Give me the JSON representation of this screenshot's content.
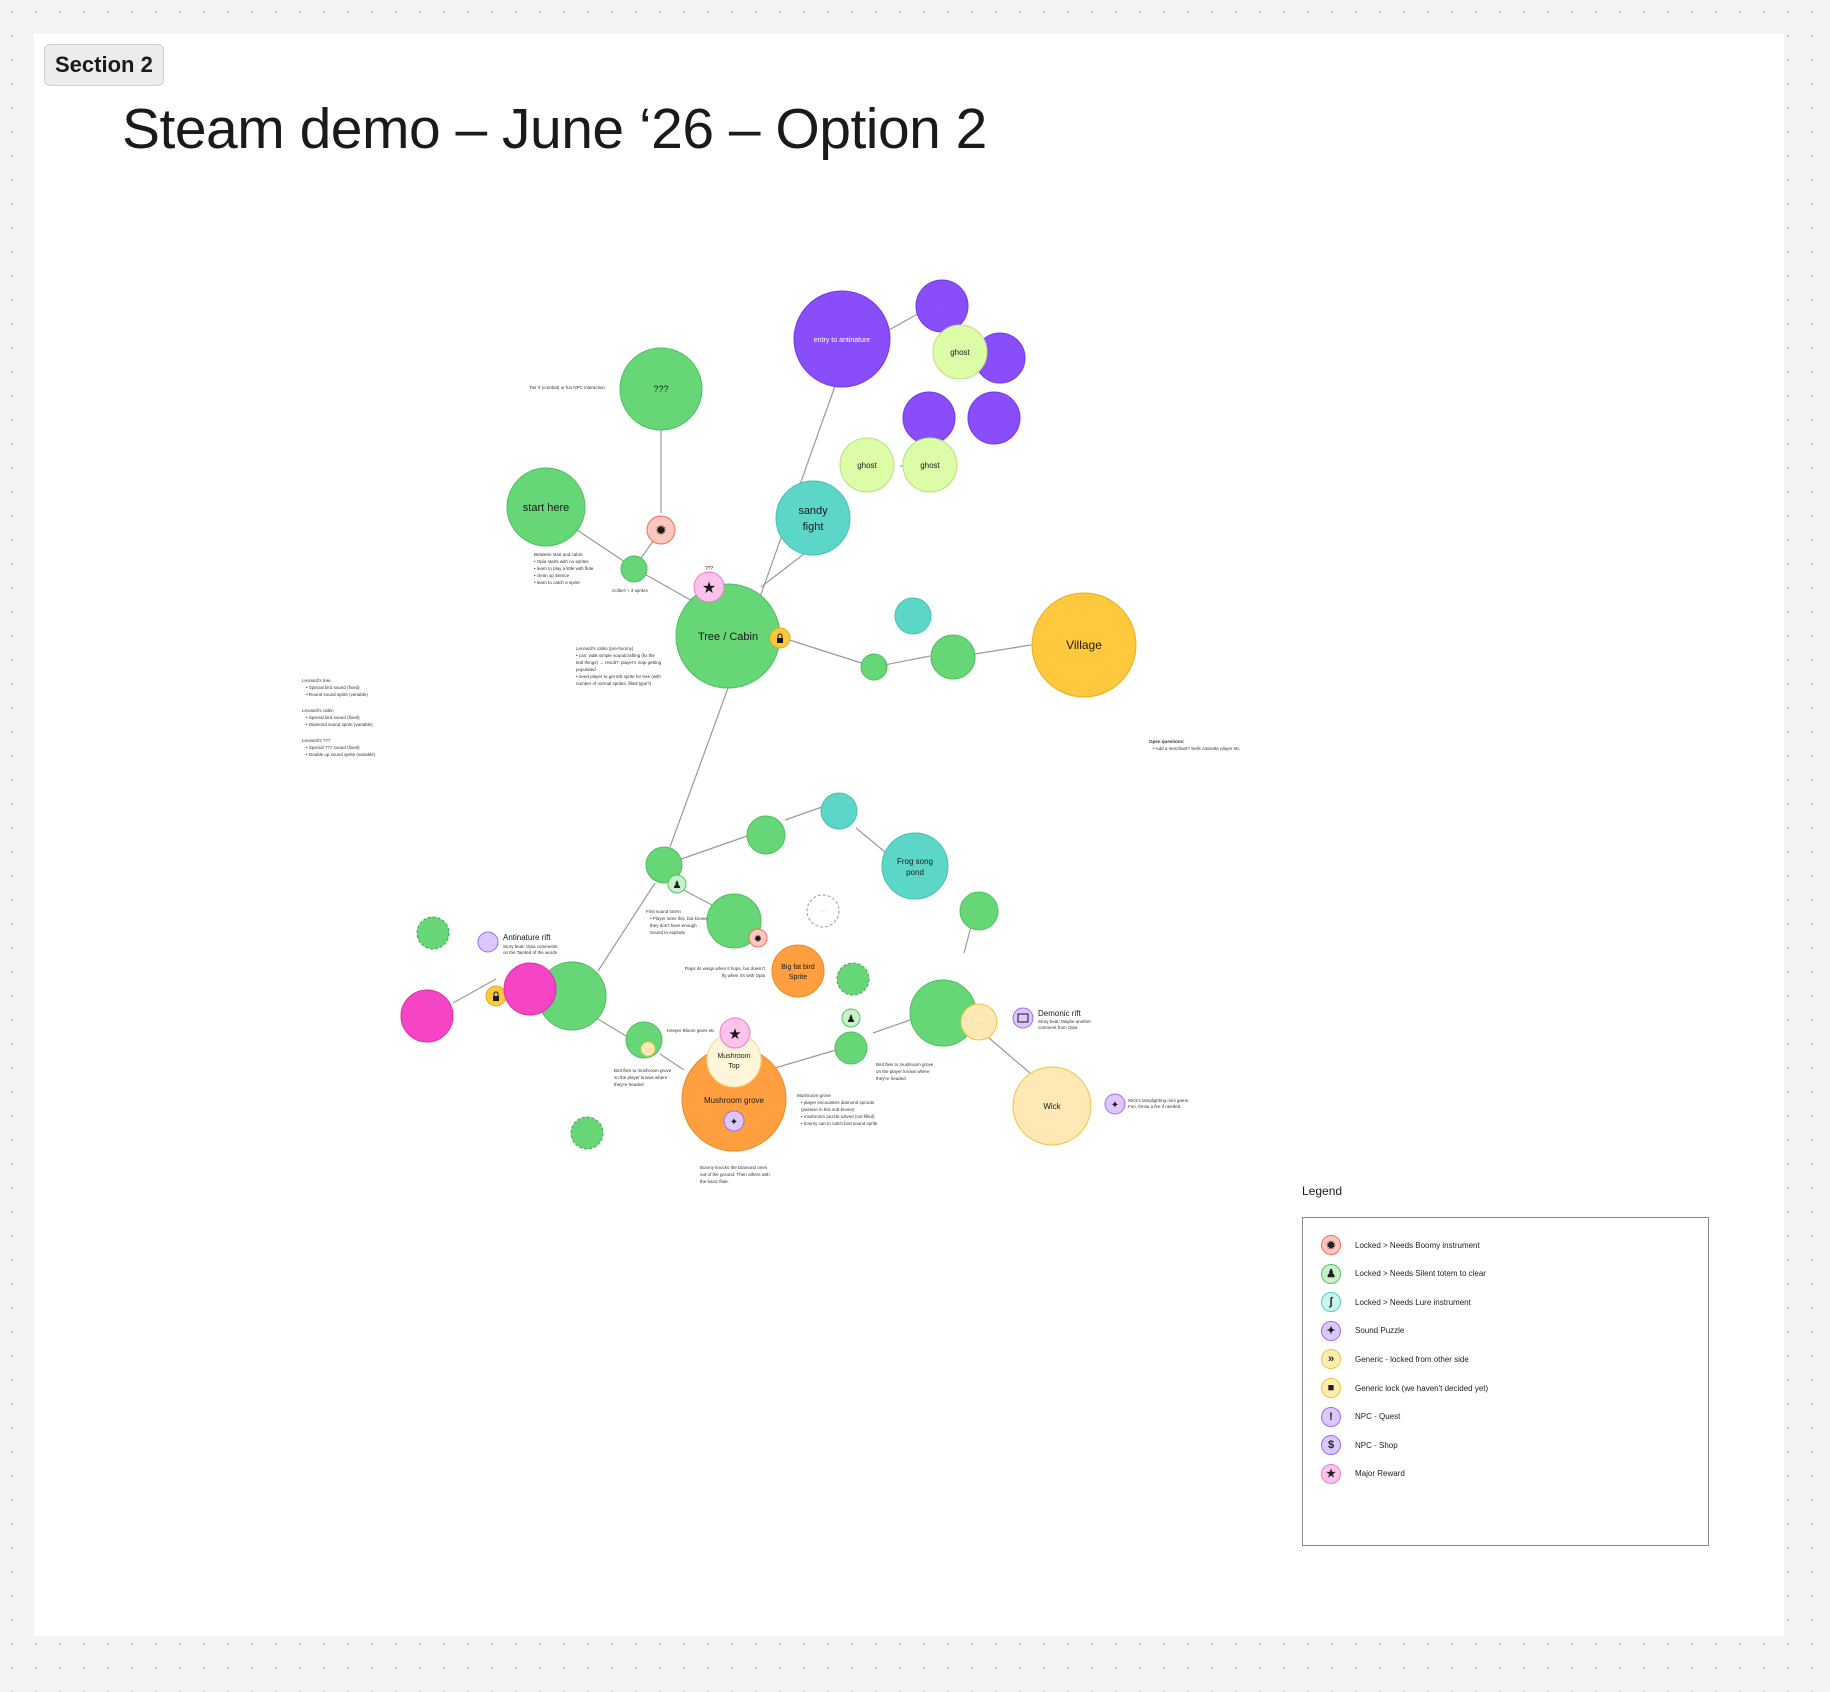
{
  "section_label": "Section 2",
  "title": "Steam demo – June ‘26 – Option 2",
  "colors": {
    "green": "#66d677",
    "teal": "#5cd6c7",
    "purple": "#8a4dfa",
    "lime": "#dcfca8",
    "yellow": "#ffc83d",
    "orange": "#ff9f40",
    "pink": "#f544c4",
    "cream": "#fde8b6"
  },
  "nodes": {
    "unknown_top": "???",
    "start": "start here",
    "tree_cabin": "Tree / Cabin",
    "sandy_fight": [
      "sandy",
      "fight"
    ],
    "entry_antinature": "entry to antinature",
    "ghost_1": "ghost",
    "ghost_2": "ghost",
    "ghost_3": "ghost",
    "village": "Village",
    "frog_song_pond": [
      "Frog song",
      "pond"
    ],
    "big_fat_bird": [
      "Big fat bird",
      "Sprite"
    ],
    "mushroom_top": [
      "Mushroom",
      "Top"
    ],
    "mushroom_grove": "Mushroom grove",
    "wick": "Wick",
    "antinature_rift": "Antinature rift",
    "demonic_rift": "Demonic rift",
    "star_label": "???"
  },
  "annotations": {
    "top_note": "Tier 3 (combat) or fun NPC interaction",
    "between_start": [
      "Between start and cabin:",
      "• Opia starts with no sprites",
      "• learn to play a little with flute",
      "• clean up silence",
      "• learn to catch a sprite"
    ],
    "collect": "Collect + 3 sprites",
    "cabin": [
      "Leonard's cabin (pre-boomy)",
      "• can: walk simple soundcrafting (fix the",
      "  leaf things) → result?: player's map getting",
      "  populated",
      "• need player to get 5/6 sprite for tree (with",
      "  number of normal sprites, filled type?)"
    ],
    "leonards": [
      {
        "title": "Leonard's tree",
        "items": [
          "• Special bird sound (fixed)",
          "• Round sound sprite (variable)"
        ]
      },
      {
        "title": "Leonard's cabin",
        "items": [
          "• Special bird sound (fixed)",
          "• Diamond sound sprite (variable)"
        ]
      },
      {
        "title": "Leonard's ???",
        "items": [
          "• Special ??? sound (fixed)",
          "• Double up sound sprite (variable)"
        ]
      }
    ],
    "open_questions": [
      "Open questions:",
      "• Add a merchant? Sells cassette player etc"
    ],
    "first_sound_totem": [
      "First sound totem",
      "• Player sees this, but knows",
      "  they don't have enough",
      "  Sound to explode"
    ],
    "flaps": [
      "Flaps its wings when it hops, but doesn't",
      "fly when it's with Opia"
    ],
    "antinature_desc": [
      "Story beat: Opia comments",
      "on the Tainted of the words"
    ],
    "keeper_bloom": "Keeper Bloom gives etc",
    "bird_flies_left": [
      "Bird flies to mushroom grove",
      "so the player knows where",
      "they're headed"
    ],
    "bird_flies_right": [
      "Bird flies to mushroom grove",
      "on the player knows where",
      "they're headed"
    ],
    "mushroom_desc": [
      "Mushroom grove",
      "• player encounters diamond sprouts",
      "  (passive in this sub-biome)",
      "• mushroom puzzle solved (not filled)",
      "• boomy can to catch bird sound sprite"
    ],
    "boomy_knocks": [
      "Boomy knocks the Diamond ones",
      "out of the ground. Then others with",
      "the basic flute."
    ],
    "demonic_desc": [
      "Story beat: Maybe another",
      "comment from Opia"
    ],
    "wick_puzzle": [
      "Wick's lamplighting mini game.",
      "Fun, throw a fire if needed"
    ]
  },
  "legend": {
    "title": "Legend",
    "items": [
      {
        "label": "Locked > Needs Boomy instrument",
        "icon": "burst-icon",
        "fill": "#ffc7bd",
        "stroke": "#f26b5b",
        "glyph": "✹"
      },
      {
        "label": "Locked > Needs Silent totem to clear",
        "icon": "totem-icon",
        "fill": "#c8f0cc",
        "stroke": "#54c463",
        "glyph": "♟"
      },
      {
        "label": "Locked > Needs Lure instrument",
        "icon": "lure-icon",
        "fill": "#c9f5ef",
        "stroke": "#4fcfc1",
        "glyph": "ʃ"
      },
      {
        "label": "Sound Puzzle",
        "icon": "puzzle-icon",
        "fill": "#dcc7ff",
        "stroke": "#9b6bf5",
        "glyph": "✦"
      },
      {
        "label": "Generic - locked from other side",
        "icon": "chevrons-icon",
        "fill": "#ffeeb0",
        "stroke": "#f0c33a",
        "glyph": "»"
      },
      {
        "label": "Generic lock (we haven't decided yet)",
        "icon": "lock-icon",
        "fill": "#ffeeb0",
        "stroke": "#f0c33a",
        "glyph": "■"
      },
      {
        "label": "NPC - Quest",
        "icon": "exclamation-icon",
        "fill": "#dcc7ff",
        "stroke": "#9b6bf5",
        "glyph": "!"
      },
      {
        "label": "NPC - Shop",
        "icon": "dollar-icon",
        "fill": "#dcc7ff",
        "stroke": "#9b6bf5",
        "glyph": "$"
      },
      {
        "label": "Major Reward",
        "icon": "star-icon",
        "fill": "#ffc2ec",
        "stroke": "#f07acb",
        "glyph": "★"
      }
    ]
  }
}
